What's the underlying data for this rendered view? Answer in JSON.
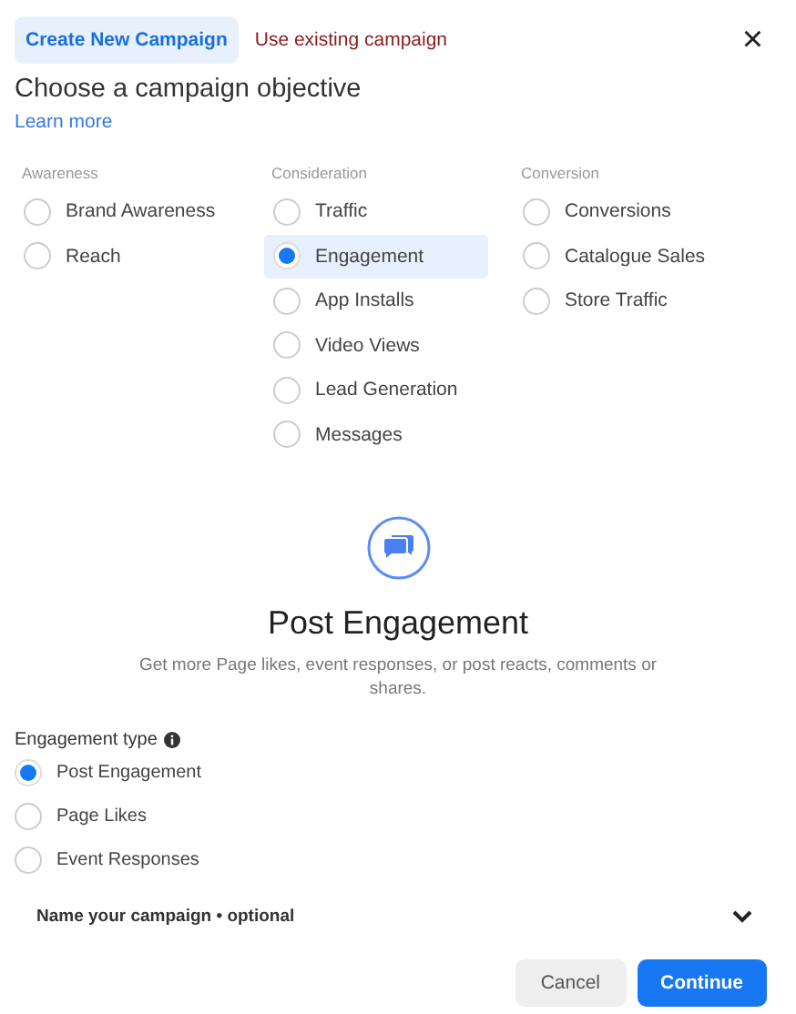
{
  "tabs": [
    {
      "label": "Create New Campaign",
      "selected": true
    },
    {
      "label": "Use existing campaign",
      "selected": false
    }
  ],
  "close": {
    "label": "×"
  },
  "heading": "Choose a campaign objective",
  "learn_more": "Learn more",
  "objective_groups": [
    {
      "title": "Awareness",
      "options": [
        {
          "label": "Brand Awareness",
          "selected": false
        },
        {
          "label": "Reach",
          "selected": false
        }
      ]
    },
    {
      "title": "Consideration",
      "options": [
        {
          "label": "Traffic",
          "selected": false
        },
        {
          "label": "Engagement",
          "selected": true
        },
        {
          "label": "App Installs",
          "selected": false
        },
        {
          "label": "Video Views",
          "selected": false
        },
        {
          "label": "Lead Generation",
          "selected": false
        },
        {
          "label": "Messages",
          "selected": false
        }
      ]
    },
    {
      "title": "Conversion",
      "options": [
        {
          "label": "Conversions",
          "selected": false
        },
        {
          "label": "Catalogue Sales",
          "selected": false
        },
        {
          "label": "Store Traffic",
          "selected": false
        }
      ]
    }
  ],
  "detail": {
    "title": "Post Engagement",
    "description": "Get more Page likes, event responses, or post reacts, comments or shares."
  },
  "engagement_type": {
    "label": "Engagement type",
    "options": [
      {
        "label": "Post Engagement",
        "selected": true
      },
      {
        "label": "Page Likes",
        "selected": false
      },
      {
        "label": "Event Responses",
        "selected": false
      }
    ]
  },
  "name_section": {
    "label": "Name your campaign • optional",
    "expanded": false
  },
  "buttons": [
    {
      "label": "Cancel",
      "kind": "secondary"
    },
    {
      "label": "Continue",
      "kind": "primary"
    }
  ]
}
